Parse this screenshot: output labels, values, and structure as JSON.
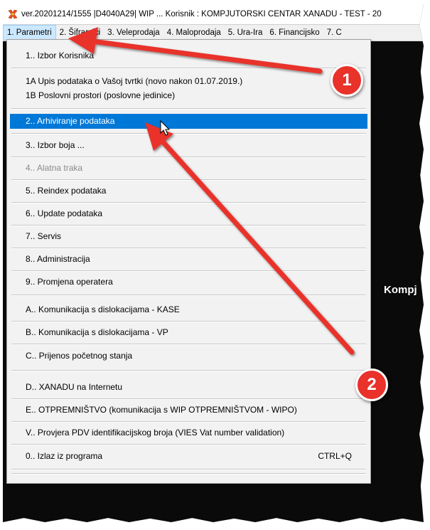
{
  "window": {
    "title": "ver.20201214/1555 |D4040A29| WIP ... Korisnik : KOMPJUTORSKI CENTAR XANADU - TEST - 20"
  },
  "menubar": [
    {
      "label": "1. Parametri",
      "active": true
    },
    {
      "label": "2. Šifrarnici",
      "active": false
    },
    {
      "label": "3. Veleprodaja",
      "active": false
    },
    {
      "label": "4. Maloprodaja",
      "active": false
    },
    {
      "label": "5. Ura-Ira",
      "active": false
    },
    {
      "label": "6. Financijsko",
      "active": false
    },
    {
      "label": "7. C",
      "active": false
    }
  ],
  "dropdown": {
    "items": [
      {
        "key": "1",
        "label": "1.. Izbor Korisnika",
        "state": "normal"
      },
      {
        "key": "1A",
        "label": "1A Upis podataka o Vašoj tvrtki (novo nakon 01.07.2019.)",
        "state": "normal"
      },
      {
        "key": "1B",
        "label": "1B Poslovni prostori (poslovne jedinice)",
        "state": "normal"
      },
      {
        "key": "2",
        "label": "2.. Arhiviranje podataka",
        "state": "selected"
      },
      {
        "key": "3",
        "label": "3.. Izbor boja ...",
        "state": "normal"
      },
      {
        "key": "4",
        "label": "4.. Alatna traka",
        "state": "disabled"
      },
      {
        "key": "5",
        "label": "5.. Reindex podataka",
        "state": "normal"
      },
      {
        "key": "6",
        "label": "6.. Update podataka",
        "state": "normal"
      },
      {
        "key": "7",
        "label": "7.. Servis",
        "state": "normal"
      },
      {
        "key": "8",
        "label": "8.. Administracija",
        "state": "normal"
      },
      {
        "key": "9",
        "label": "9.. Promjena operatera",
        "state": "normal"
      },
      {
        "key": "A",
        "label": "A.. Komunikacija s dislokacijama - KASE",
        "state": "normal"
      },
      {
        "key": "B",
        "label": "B.. Komunikacija s dislokacijama - VP",
        "state": "normal"
      },
      {
        "key": "C",
        "label": "C.. Prijenos početnog stanja",
        "state": "normal"
      },
      {
        "key": "D",
        "label": "D.. XANADU na Internetu",
        "state": "normal"
      },
      {
        "key": "E",
        "label": "E.. OTPREMNIŠTVO (komunikacija s WIP OTPREMNIŠTVOM - WIPO)",
        "state": "normal"
      },
      {
        "key": "V",
        "label": "V.. Provjera PDV identifikacijskog broja (VIES Vat number validation)",
        "state": "normal"
      },
      {
        "key": "0",
        "label": "0.. Izlaz iz programa",
        "state": "normal",
        "shortcut": "CTRL+Q"
      }
    ]
  },
  "background": {
    "label": "Kompj"
  },
  "annotations": {
    "badge1": "1",
    "badge2": "2",
    "color": "#e8322a"
  }
}
